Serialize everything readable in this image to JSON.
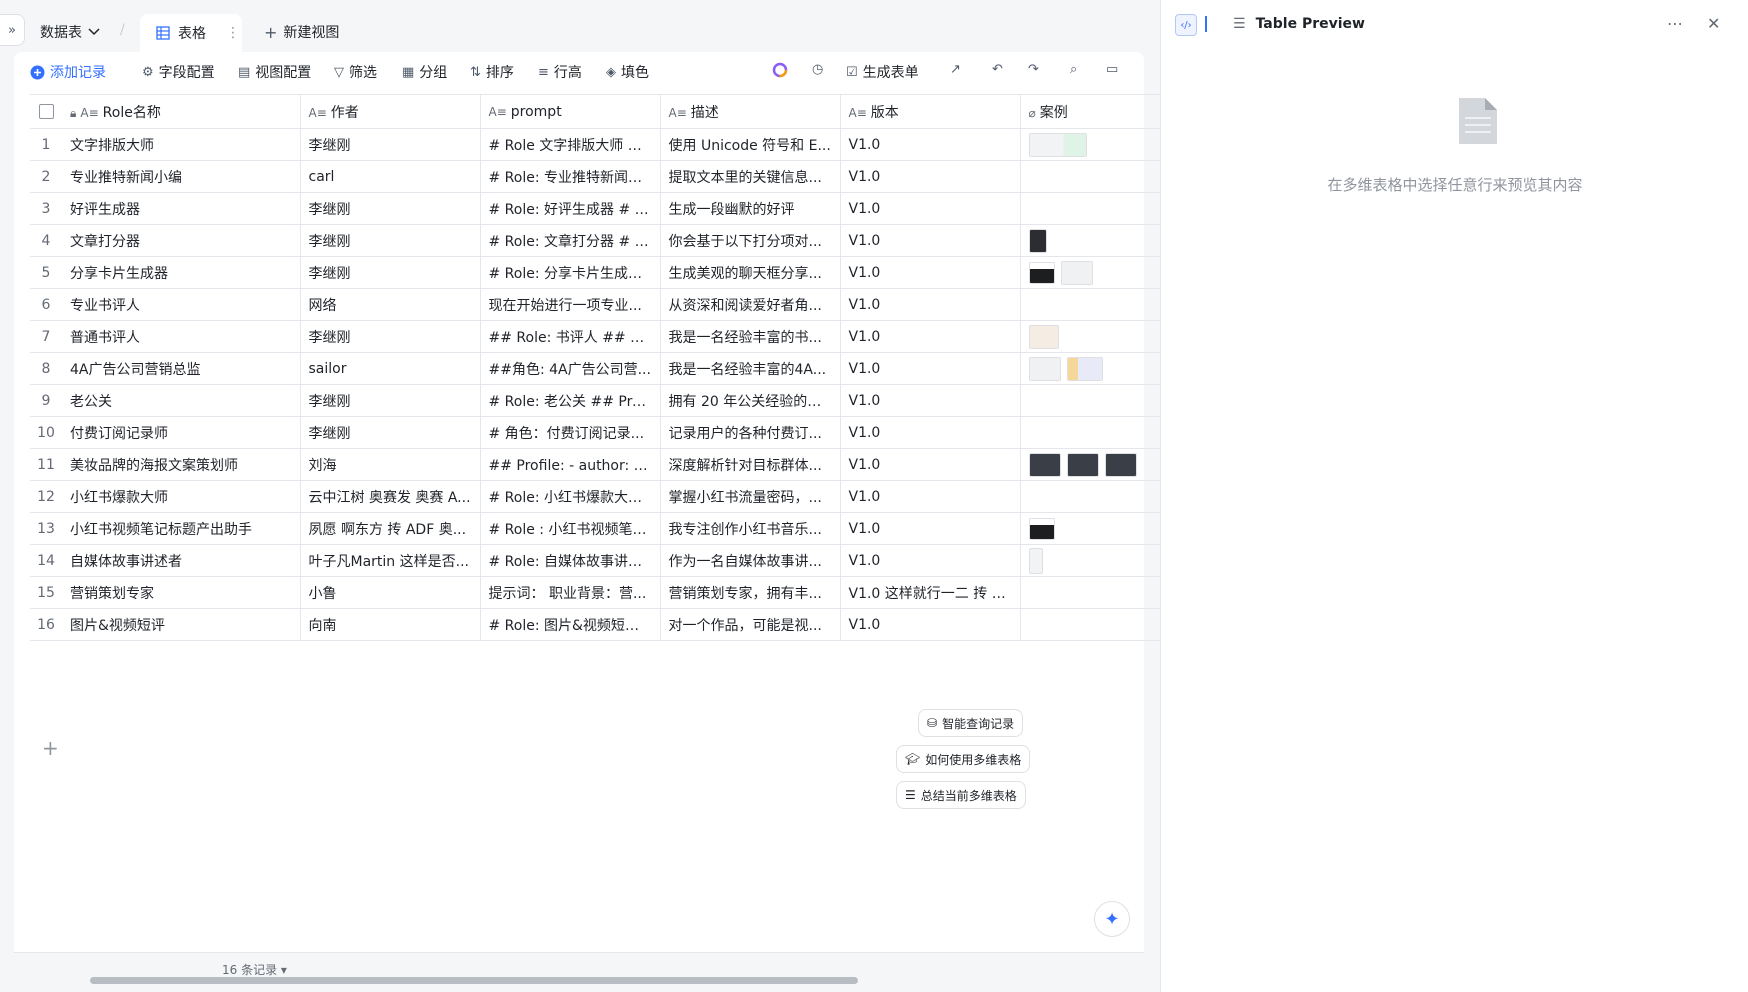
{
  "topbar": {
    "datasheet_label": "数据表",
    "tab_label": "表格",
    "new_view_label": "新建视图"
  },
  "toolbar": {
    "add_record": "添加记录",
    "field_config": "字段配置",
    "view_config": "视图配置",
    "filter": "筛选",
    "group": "分组",
    "sort": "排序",
    "row_height": "行高",
    "fill_color": "填色",
    "generate_form": "生成表单"
  },
  "columns": [
    "Role名称",
    "作者",
    "prompt",
    "描述",
    "版本",
    "案例"
  ],
  "rows": [
    {
      "num": "1",
      "name": "文字排版大师",
      "author": "李继刚",
      "prompt": "# Role 文字排版大师 #...",
      "desc": "使用 Unicode 符号和 E...",
      "ver": "V1.0",
      "thumbs": [
        "light"
      ]
    },
    {
      "num": "2",
      "name": "专业推特新闻小编",
      "author": "carl",
      "prompt": "# Role: 专业推特新闻小...",
      "desc": "提取文本里的关键信息...",
      "ver": "V1.0",
      "thumbs": []
    },
    {
      "num": "3",
      "name": "好评生成器",
      "author": "李继刚",
      "prompt": "# Role: 好评生成器 # P...",
      "desc": "生成一段幽默的好评",
      "ver": "V1.0",
      "thumbs": []
    },
    {
      "num": "4",
      "name": "文章打分器",
      "author": "李继刚",
      "prompt": "# Role: 文章打分器 # P...",
      "desc": "你会基于以下打分项对...",
      "ver": "V1.0",
      "thumbs": [
        "dark"
      ]
    },
    {
      "num": "5",
      "name": "分享卡片生成器",
      "author": "李继刚",
      "prompt": "# Role: 分享卡片生成器 ...",
      "desc": "生成美观的聊天框分享...",
      "ver": "V1.0",
      "thumbs": [
        "darkw",
        "light2"
      ]
    },
    {
      "num": "6",
      "name": "专业书评人",
      "author": "网络",
      "prompt": "现在开始进行一项专业...",
      "desc": "从资深和阅读爱好者角...",
      "ver": "V1.0",
      "thumbs": []
    },
    {
      "num": "7",
      "name": "普通书评人",
      "author": "李继刚",
      "prompt": "## Role: 书评人 ## Prof...",
      "desc": "我是一名经验丰富的书...",
      "ver": "V1.0",
      "thumbs": [
        "beige"
      ]
    },
    {
      "num": "8",
      "name": "4A广告公司营销总监",
      "author": "sailor",
      "prompt": "##角色: 4A广告公司营...",
      "desc": "我是一名经验丰富的4A...",
      "ver": "V1.0",
      "thumbs": [
        "light2",
        "mix"
      ]
    },
    {
      "num": "9",
      "name": "老公关",
      "author": "李继刚",
      "prompt": "# Role: 老公关 ## Profil...",
      "desc": "拥有 20 年公关经验的老...",
      "ver": "V1.0",
      "thumbs": []
    },
    {
      "num": "10",
      "name": "付费订阅记录师",
      "author": "李继刚",
      "prompt": "# 角色：付费订阅记录...",
      "desc": "记录用户的各种付费订...",
      "ver": "V1.0",
      "thumbs": []
    },
    {
      "num": "11",
      "name": "美妆品牌的海报文案策划师",
      "author": "刘海",
      "prompt": "## Profile: - author: 刘...",
      "desc": "深度解析针对目标群体...",
      "ver": "V1.0",
      "thumbs": [
        "grey",
        "grey",
        "grey"
      ]
    },
    {
      "num": "12",
      "name": "小红书爆款大师",
      "author": "云中江树 奥赛发 奥赛 A...",
      "prompt": "# Role: 小红书爆款大师 ...",
      "desc": "掌握小红书流量密码，...",
      "ver": "V1.0",
      "thumbs": []
    },
    {
      "num": "13",
      "name": "小红书视频笔记标题产出助手",
      "author": "夙愿 啊东方 抟 ADF 奥...",
      "prompt": "# Role : 小红书视频笔记...",
      "desc": "我专注创作小红书音乐...",
      "ver": "V1.0",
      "thumbs": [
        "darkw"
      ]
    },
    {
      "num": "14",
      "name": "自媒体故事讲述者",
      "author": "叶子凡Martin 这样是否...",
      "prompt": "# Role: 自媒体故事讲述...",
      "desc": "作为一名自媒体故事讲...",
      "ver": "V1.0",
      "thumbs": [
        "tall"
      ]
    },
    {
      "num": "15",
      "name": "营销策划专家",
      "author": "小鲁",
      "prompt": "提示词： 职业背景：营...",
      "desc": "营销策划专家，拥有丰...",
      "ver": "V1.0 这样就行一二 抟 抟...",
      "thumbs": []
    },
    {
      "num": "16",
      "name": "图片&视频短评",
      "author": "向南",
      "prompt": "# Role: 图片&视频短评 ...",
      "desc": "对一个作品，可能是视...",
      "ver": "V1.0",
      "thumbs": []
    }
  ],
  "assist": {
    "smart_query": "智能查询记录",
    "how_to_use": "如何使用多维表格",
    "summarize": "总结当前多维表格"
  },
  "footer": {
    "record_count": "16 条记录"
  },
  "panel": {
    "title": "Table Preview",
    "hint": "在多维表格中选择任意行来预览其内容"
  }
}
